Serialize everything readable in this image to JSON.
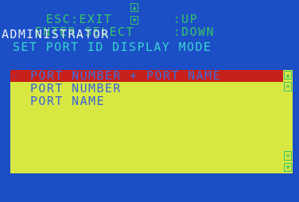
{
  "hints": {
    "esc_key": "ESC",
    "esc_action": "EXIT",
    "enter_key": "ENTER",
    "enter_action": "SELECT",
    "up_action": "UP",
    "down_action": "DOWN",
    "separator": ":"
  },
  "header": {
    "user": "ADMINISTRATOR",
    "function": "SET PORT ID DISPLAY MODE"
  },
  "options": [
    {
      "label": "PORT NUMBER + PORT NAME",
      "selected": true
    },
    {
      "label": "PORT NUMBER",
      "selected": false
    },
    {
      "label": "PORT NAME",
      "selected": false
    }
  ],
  "icons": {
    "up_arrow": "up-arrow-icon",
    "down_arrow": "down-arrow-icon",
    "pointer": "pointer-icon"
  },
  "colors": {
    "background": "#1c4ec6",
    "panel": "#d7e842",
    "selection": "#c8201a",
    "hint_text": "#36c36a",
    "title_text": "#e9edf6",
    "subtitle_text": "#39d3cf",
    "option_text": "#3b60d8"
  }
}
